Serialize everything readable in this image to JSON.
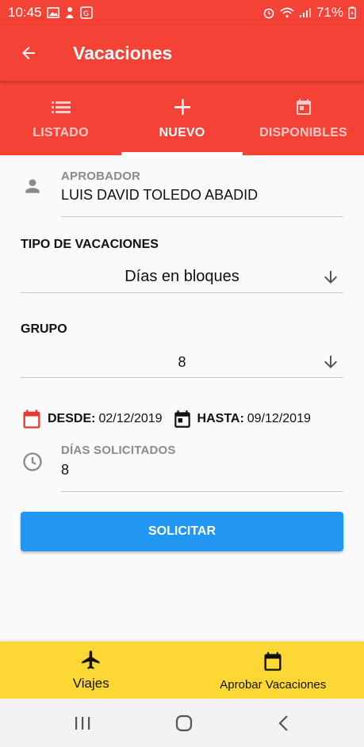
{
  "status_bar": {
    "time": "10:45",
    "battery": "71%"
  },
  "app_bar": {
    "title": "Vacaciones",
    "back_icon": "arrow-back-icon"
  },
  "tabs": [
    {
      "label": "LISTADO",
      "icon": "list-icon"
    },
    {
      "label": "NUEVO",
      "icon": "plus-icon",
      "active": true
    },
    {
      "label": "DISPONIBLES",
      "icon": "calendar-icon"
    }
  ],
  "form": {
    "approver": {
      "label": "APROBADOR",
      "value": "LUIS DAVID TOLEDO ABADID"
    },
    "vacation_type": {
      "label": "TIPO DE VACACIONES",
      "value": "Días en bloques"
    },
    "group": {
      "label": "GRUPO",
      "value": "8"
    },
    "from": {
      "label": "DESDE:",
      "value": "02/12/2019"
    },
    "to": {
      "label": "HASTA:",
      "value": "09/12/2019"
    },
    "days_requested": {
      "label": "DÍAS SOLICITADOS",
      "value": "8"
    },
    "submit_label": "SOLICITAR"
  },
  "bottom_nav": [
    {
      "label": "Viajes",
      "icon": "airplane-icon"
    },
    {
      "label": "Aprobar Vacaciones",
      "icon": "calendar-icon"
    }
  ],
  "colors": {
    "primary": "#f44336",
    "accent": "#2196f3",
    "bottom_nav": "#fdd835"
  }
}
